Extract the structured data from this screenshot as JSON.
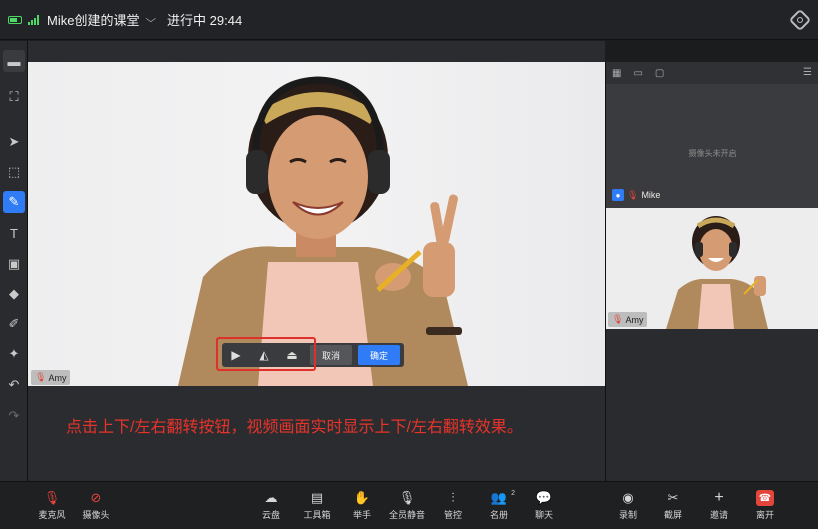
{
  "topbar": {
    "room_title": "Mike创建的课堂",
    "status": "进行中 29:44"
  },
  "main_video": {
    "participant": "Amy"
  },
  "flip_bar": {
    "cancel_label": "取消",
    "confirm_label": "确定"
  },
  "caption": "点击上下/左右翻转按钮，视频画面实时显示上下/左右翻转效果。",
  "right_panel": {
    "camera_off_text": "摄像头未开启",
    "host_name": "Mike",
    "thumb_name": "Amy"
  },
  "bottombar": {
    "mic": "麦克风",
    "camera": "摄像头",
    "cloud": "云盘",
    "toolbox": "工具箱",
    "raise_hand": "举手",
    "mute_all": "全员静音",
    "control": "管控",
    "roster": "名册",
    "roster_count": "2",
    "chat": "聊天",
    "record": "录制",
    "screenshot": "截屏",
    "invite": "邀请",
    "leave": "离开"
  },
  "colors": {
    "accent": "#2f7cf6",
    "danger": "#e3453b",
    "caption": "#e8332b",
    "signal": "#4cd964"
  }
}
